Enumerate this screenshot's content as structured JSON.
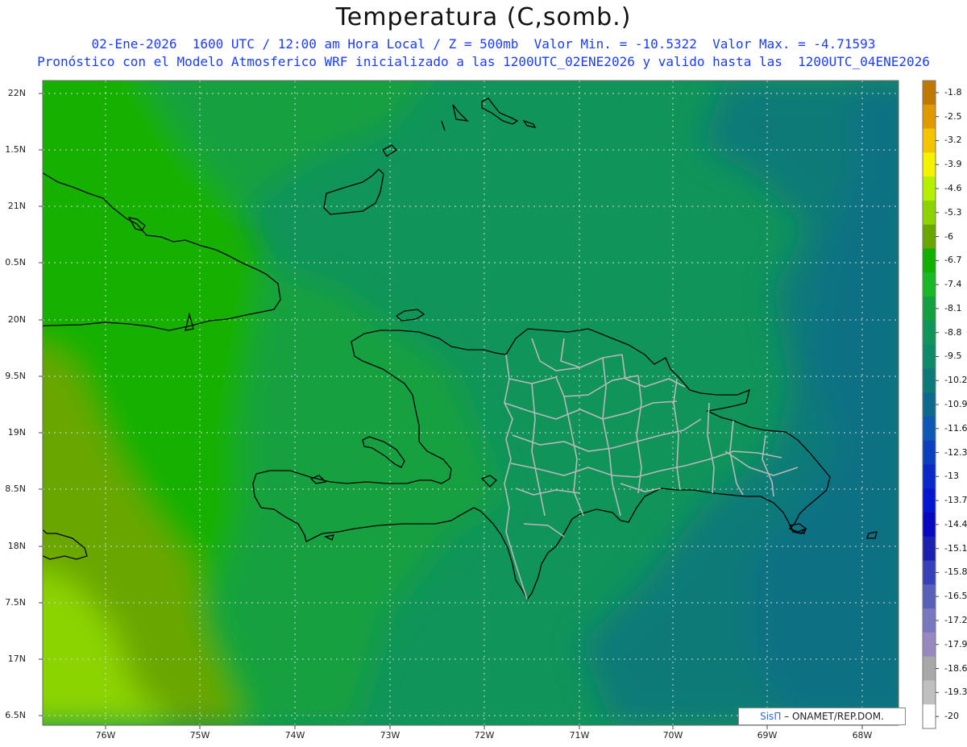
{
  "header": {
    "title": "Temperatura (C,somb.)",
    "subtitle1": "02-Ene-2026  1600 UTC / 12:00 am Hora Local / Z = 500mb  Valor Min. = -10.5322  Valor Max. = -4.71593",
    "subtitle2": "Pronóstico con el Modelo Atmosferico WRF inicializado a las 1200UTC_02ENE2026 y valido hasta las  1200UTC_04ENE2026"
  },
  "axes": {
    "lat_labels": [
      "22N",
      "1.5N",
      "21N",
      "0.5N",
      "20N",
      "9.5N",
      "19N",
      "8.5N",
      "18N",
      "7.5N",
      "17N",
      "6.5N"
    ],
    "lon_labels": [
      "76W",
      "75W",
      "74W",
      "73W",
      "72W",
      "71W",
      "70W",
      "69W",
      "68W"
    ]
  },
  "colorbar": {
    "labels": [
      "-1.8",
      "-2.5",
      "-3.2",
      "-3.9",
      "-4.6",
      "-5.3",
      "-6",
      "-6.7",
      "-7.4",
      "-8.1",
      "-8.8",
      "-9.5",
      "-10.2",
      "-10.9",
      "-11.6",
      "-12.3",
      "-13",
      "-13.7",
      "-14.4",
      "-15.1",
      "-15.8",
      "-16.5",
      "-17.2",
      "-17.9",
      "-18.6",
      "-19.3",
      "-20"
    ],
    "colors": [
      "#c07800",
      "#e09a00",
      "#f5c400",
      "#f5f200",
      "#b4f000",
      "#8cd400",
      "#6aa600",
      "#12b000",
      "#18b828",
      "#12a040",
      "#10945a",
      "#0e8a6a",
      "#0e7a78",
      "#0e6a8c",
      "#0c58b4",
      "#0a40c0",
      "#0828c8",
      "#0616d0",
      "#0808c0",
      "#1c20b0",
      "#3840b8",
      "#5860b8",
      "#7878c0",
      "#9888c0",
      "#a8a8a8",
      "#c0c0c0",
      "#ffffff"
    ]
  },
  "credit": {
    "brand": "SisΠ",
    "text": "– ONAMET/REP.DOM."
  }
}
